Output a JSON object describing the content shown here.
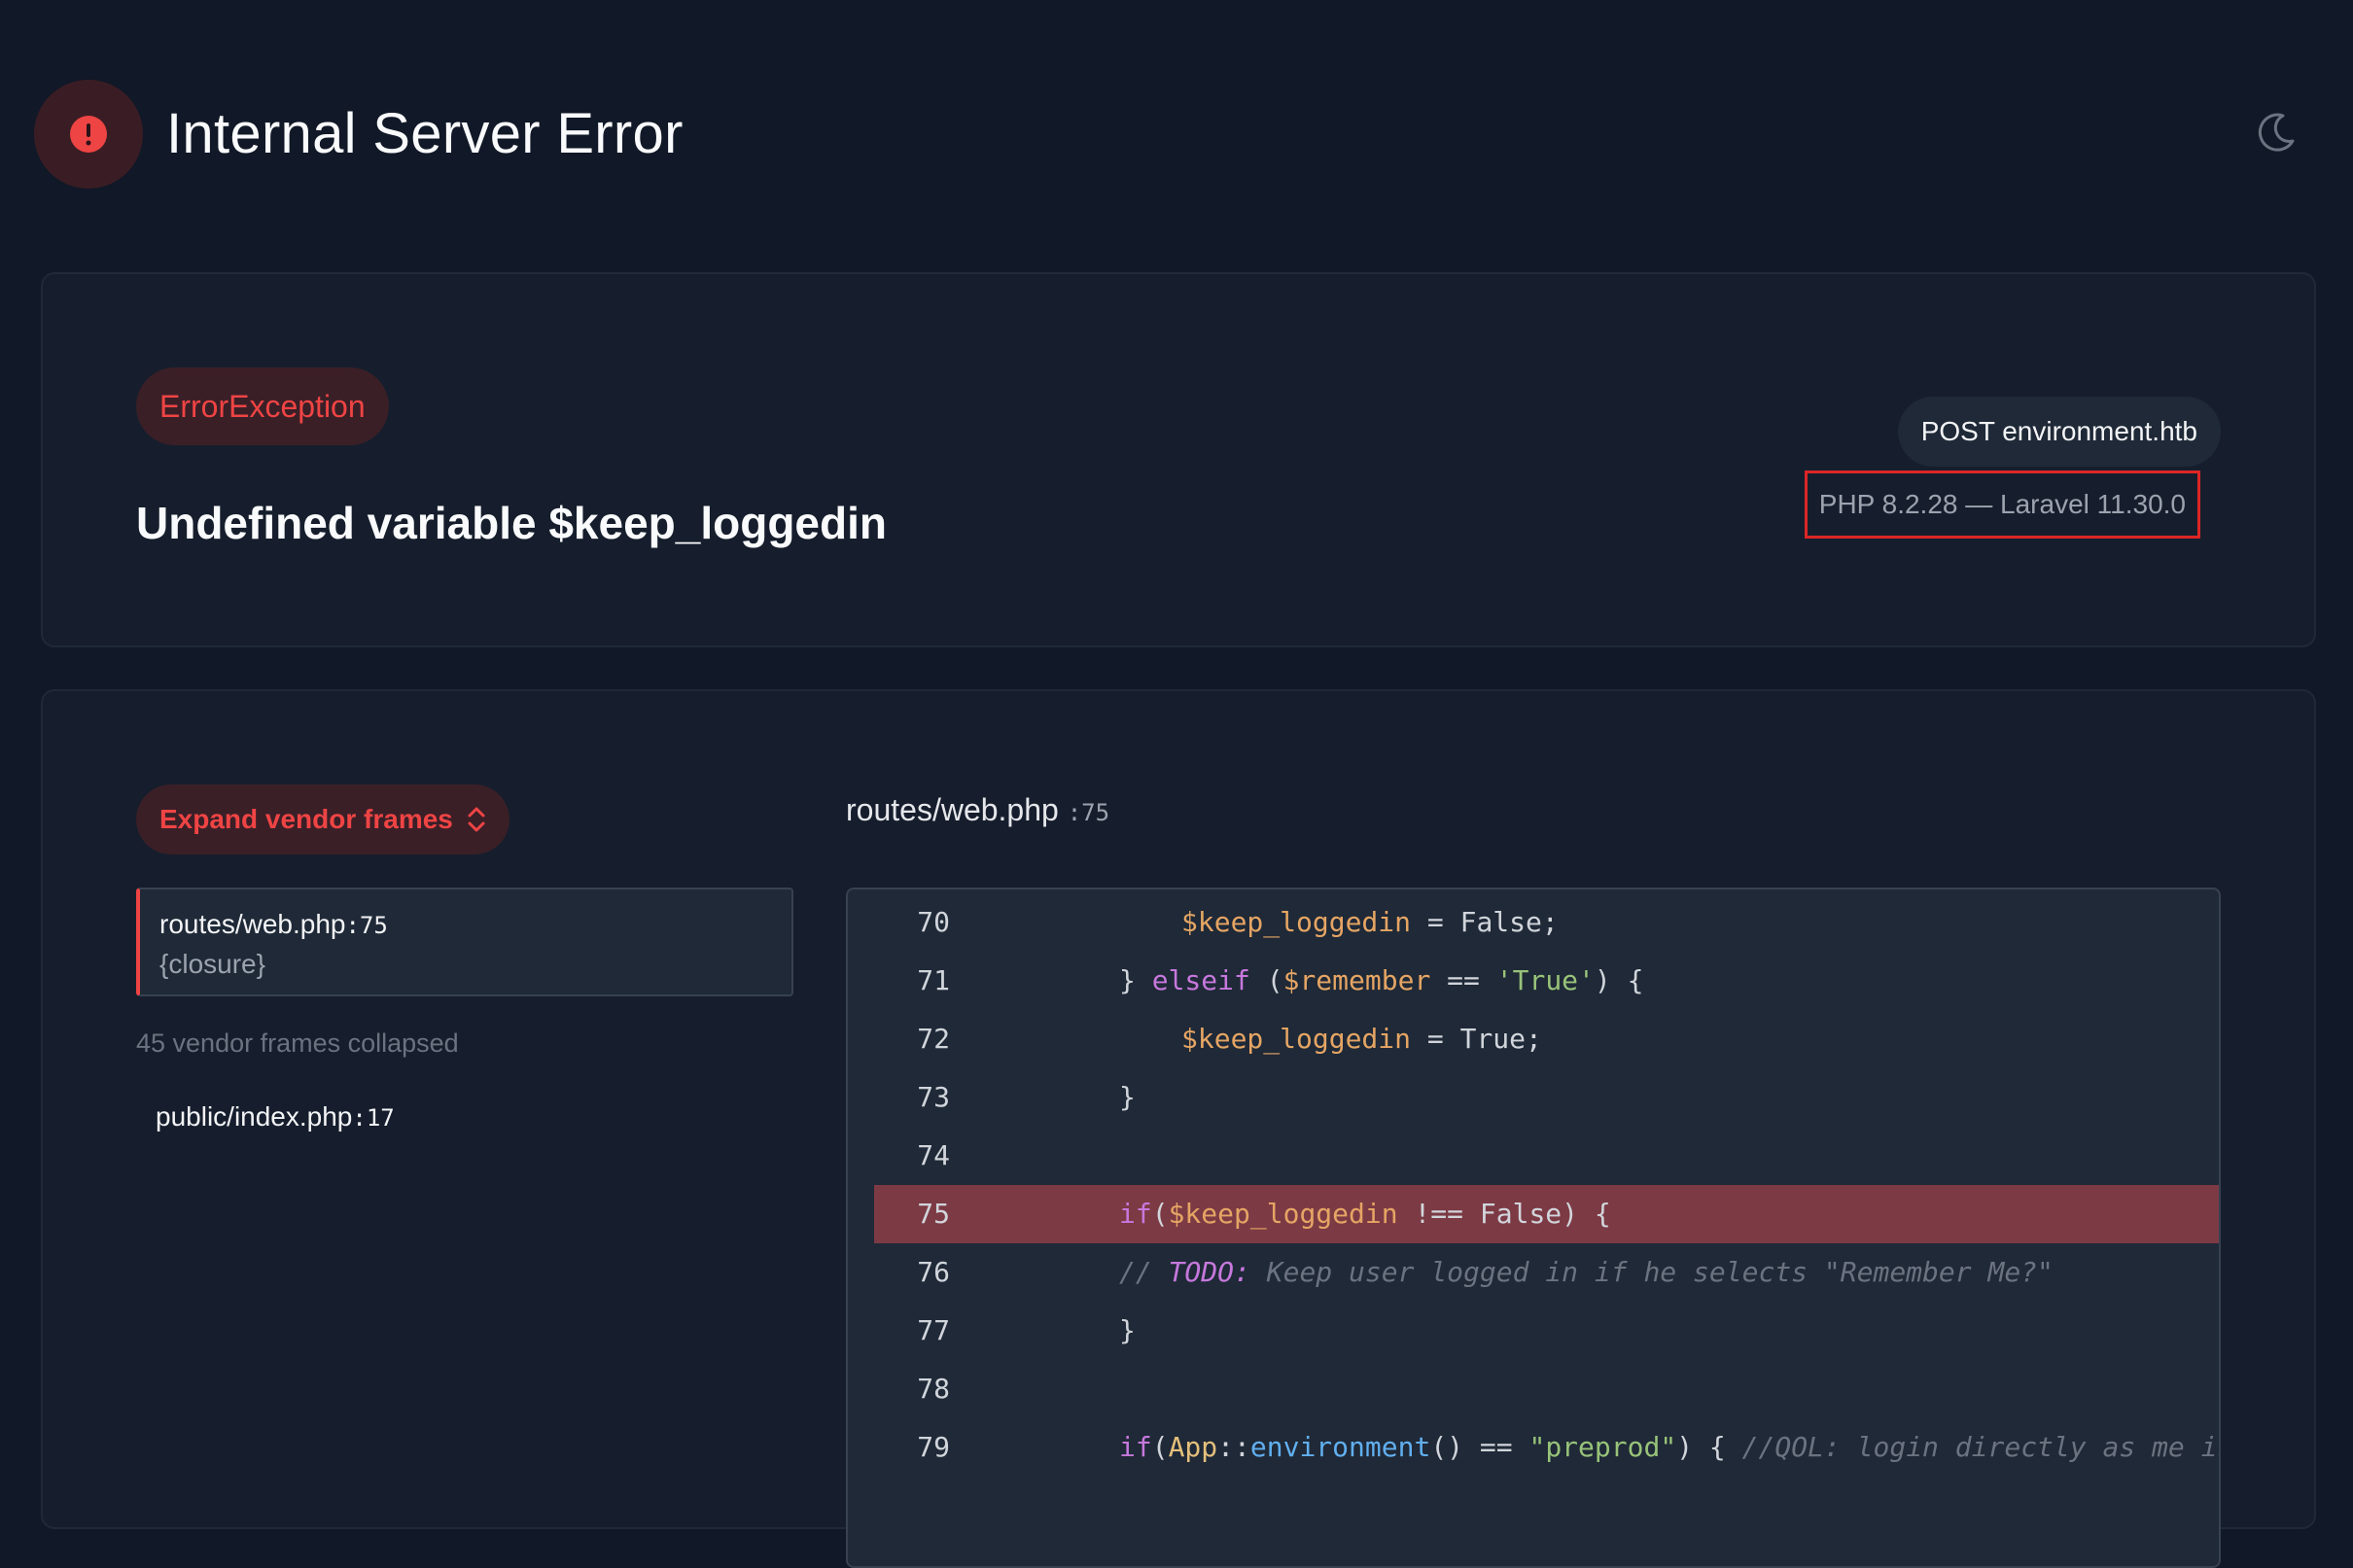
{
  "header": {
    "title": "Internal Server Error",
    "icon": "alert-circle-icon",
    "theme_toggle_icon": "moon-icon"
  },
  "exception": {
    "type": "ErrorException",
    "message": "Undefined variable $keep_loggedin",
    "request": "POST environment.htb",
    "versions": "PHP 8.2.28 — Laravel 11.30.0"
  },
  "frames": {
    "expand_label": "Expand vendor frames",
    "active": {
      "file": "routes/web.php",
      "line": ":75",
      "function": "{closure}"
    },
    "collapsed_note": "45 vendor frames collapsed",
    "vendor": {
      "file": "public/index.php",
      "line": ":17"
    }
  },
  "code": {
    "file": "routes/web.php",
    "line": ":75",
    "highlight_line": 75,
    "lines": [
      {
        "n": "70",
        "indent": 2,
        "tokens": [
          [
            "var",
            "$keep_loggedin"
          ],
          [
            "plain",
            " = False;"
          ]
        ]
      },
      {
        "n": "71",
        "indent": 1,
        "tokens": [
          [
            "plain",
            "} "
          ],
          [
            "kw",
            "elseif"
          ],
          [
            "plain",
            " ("
          ],
          [
            "var",
            "$remember"
          ],
          [
            "plain",
            " == "
          ],
          [
            "str",
            "'True'"
          ],
          [
            "plain",
            ") {"
          ]
        ]
      },
      {
        "n": "72",
        "indent": 2,
        "tokens": [
          [
            "var",
            "$keep_loggedin"
          ],
          [
            "plain",
            " = True;"
          ]
        ]
      },
      {
        "n": "73",
        "indent": 1,
        "tokens": [
          [
            "plain",
            "}"
          ]
        ]
      },
      {
        "n": "74",
        "indent": 0,
        "tokens": []
      },
      {
        "n": "75",
        "indent": 1,
        "tokens": [
          [
            "kw",
            "if"
          ],
          [
            "plain",
            "("
          ],
          [
            "var",
            "$keep_loggedin"
          ],
          [
            "plain",
            " !== False) {"
          ]
        ]
      },
      {
        "n": "76",
        "indent": 1,
        "tokens": [
          [
            "cmt",
            "// "
          ],
          [
            "todo",
            "TODO:"
          ],
          [
            "cmt",
            " Keep user logged in if he selects \"Remember Me?\""
          ]
        ]
      },
      {
        "n": "77",
        "indent": 1,
        "tokens": [
          [
            "plain",
            "}"
          ]
        ]
      },
      {
        "n": "78",
        "indent": 0,
        "tokens": []
      },
      {
        "n": "79",
        "indent": 1,
        "tokens": [
          [
            "kw",
            "if"
          ],
          [
            "plain",
            "("
          ],
          [
            "cls",
            "App"
          ],
          [
            "plain",
            "::"
          ],
          [
            "fn",
            "environment"
          ],
          [
            "plain",
            "() == "
          ],
          [
            "str",
            "\"preprod\""
          ],
          [
            "plain",
            ") { "
          ],
          [
            "cmt",
            "//QOL: login directly as me in de"
          ]
        ]
      }
    ]
  },
  "colors": {
    "background": "#111827",
    "panel": "#161e2d",
    "accent_red": "#ef4444",
    "highlight_row": "#7c3a44"
  }
}
